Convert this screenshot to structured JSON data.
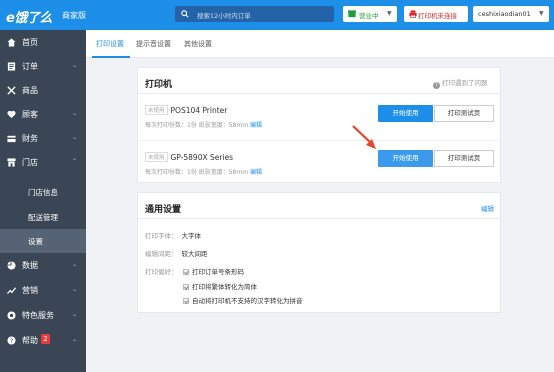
{
  "brand": {
    "logo_text": "e饿了么",
    "sub_text": "商家版"
  },
  "search": {
    "placeholder": "搜索12小时内订单"
  },
  "topbar": {
    "status_label": "营业中",
    "printer_status": "打印机未连接",
    "user_name": "ceshixiaodian01"
  },
  "sidebar": {
    "items": [
      {
        "label": "首页",
        "icon": "home-icon"
      },
      {
        "label": "订单",
        "icon": "order-icon"
      },
      {
        "label": "商品",
        "icon": "goods-icon"
      },
      {
        "label": "顾客",
        "icon": "heart-icon"
      },
      {
        "label": "财务",
        "icon": "finance-icon"
      },
      {
        "label": "门店",
        "icon": "store-icon"
      },
      {
        "label": "门店信息"
      },
      {
        "label": "配送管理"
      },
      {
        "label": "设置"
      },
      {
        "label": "数据",
        "icon": "chart-icon"
      },
      {
        "label": "营销",
        "icon": "marketing-icon"
      },
      {
        "label": "特色服务",
        "icon": "service-icon"
      },
      {
        "label": "帮助",
        "icon": "help-icon",
        "badge": "2"
      }
    ]
  },
  "tabs": [
    "打印设置",
    "提示音设置",
    "其他设置"
  ],
  "printer_card": {
    "title": "打印机",
    "help_text": "打印遇到了问题",
    "printers": [
      {
        "tag": "未使用",
        "name": "POS104 Printer",
        "meta_prefix": "每次打印份数：1份  纸张宽度：58mm",
        "edit": "编辑",
        "start_label": "开始使用",
        "test_label": "打印测试页"
      },
      {
        "tag": "未使用",
        "name": "GP-5890X Series",
        "meta_prefix": "每次打印份数：1份  纸张宽度：58mm",
        "edit": "编辑",
        "start_label": "开始使用",
        "test_label": "打印测试页"
      }
    ]
  },
  "general_card": {
    "title": "通用设置",
    "edit": "编辑",
    "font_label": "打印字体：",
    "font_value": "大字体",
    "spacing_label": "编辑间距：",
    "spacing_value": "较大间距",
    "pref_label": "打印偏好：",
    "prefs": [
      "打印订单号条形码",
      "打印将繁体转化为简体",
      "自动将打印机不支持的汉字转化为拼音"
    ]
  },
  "colors": {
    "brand_blue": "#1e8fe8",
    "sidebar_bg": "#3a4555",
    "arrow_red": "#e8452c",
    "badge_red": "#e53b3b"
  }
}
